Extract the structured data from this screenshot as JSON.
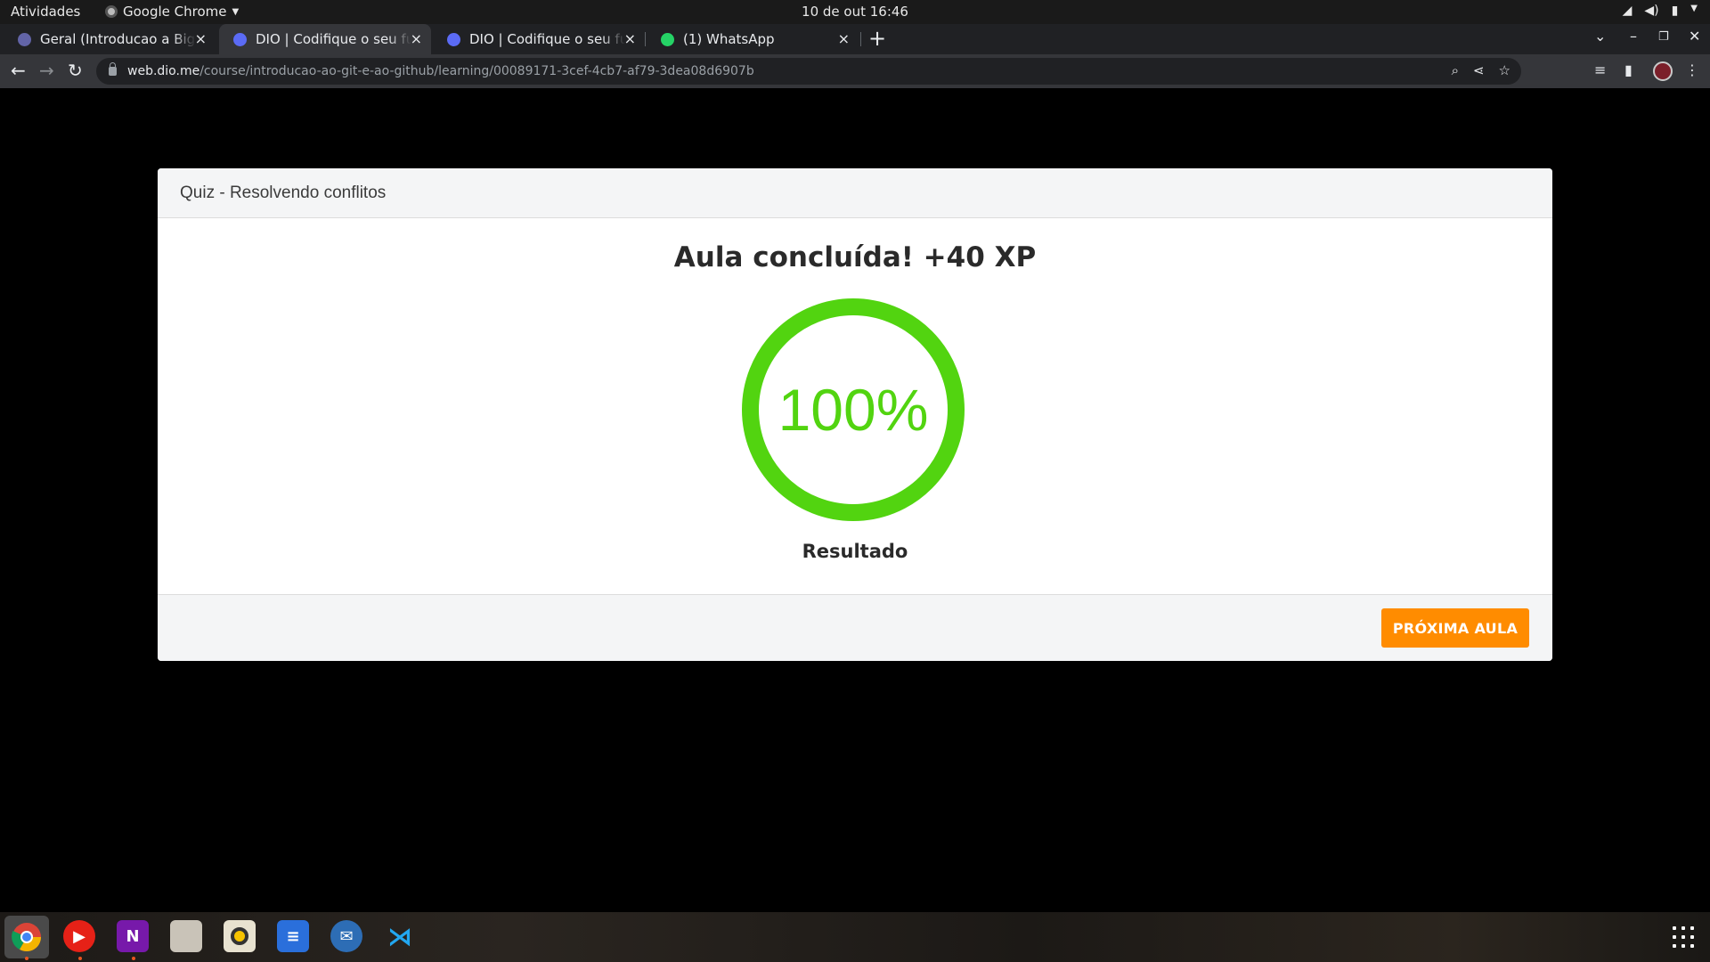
{
  "system_bar": {
    "activities": "Atividades",
    "app_name": "Google Chrome",
    "clock": "10 de out  16:46"
  },
  "tabs": [
    {
      "title": "Geral (Introducao a Big Data",
      "favicon_color": "#6264a7",
      "close": "×"
    },
    {
      "title": "DIO | Codifique o seu futuro",
      "favicon_color": "#5b6bf5",
      "close": "×"
    },
    {
      "title": "DIO | Codifique o seu futuro",
      "favicon_color": "#5b6bf5",
      "close": "×"
    },
    {
      "title": "(1) WhatsApp",
      "favicon_color": "#25d366",
      "close": "×"
    }
  ],
  "new_tab": "+",
  "address_bar": {
    "host": "web.dio.me",
    "path": "/course/introducao-ao-git-e-ao-github/learning/00089171-3cef-4cb7-af79-3dea08d6907b"
  },
  "modal": {
    "header_title": "Quiz - Resolvendo conflitos",
    "result_title": "Aula concluída! +40 XP",
    "progress_text": "100%",
    "progress_value": 1.0,
    "result_label": "Resultado",
    "next_button": "PRÓXIMA AULA",
    "accent_color": "#52d410",
    "button_color": "#ff8c00"
  },
  "dock": {
    "apps": [
      "chrome-icon",
      "youtube-music-icon",
      "onenote-icon",
      "files-icon",
      "rhythmbox-icon",
      "text-editor-icon",
      "thunderbird-icon",
      "vscode-icon"
    ]
  }
}
